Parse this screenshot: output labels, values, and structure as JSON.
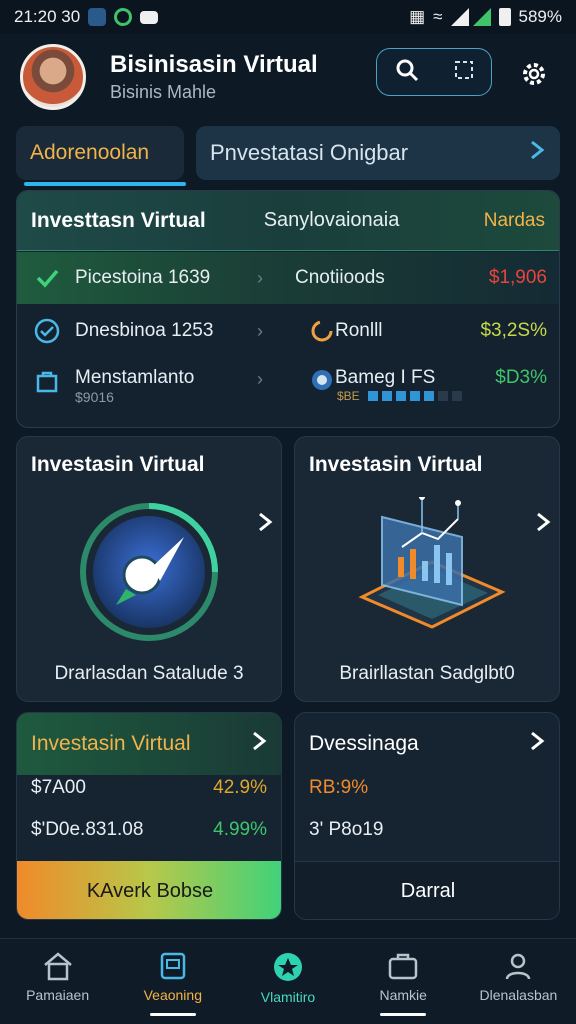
{
  "status_bar": {
    "time": "21:20 30",
    "battery": "589%"
  },
  "header": {
    "title": "Bisinisasin Virtual",
    "subtitle": "Bisinis Mahle"
  },
  "tabs": {
    "primary_label": "Adorenoolan",
    "secondary_label": "Pnvestatasi Onigbar"
  },
  "invest_card": {
    "title": "Investtasn Virtual",
    "col2": "Sanylovaionaia",
    "col3": "Nardas",
    "rows": [
      {
        "label": "Picestoina 1639",
        "right_label": "Cnotiioods",
        "value": "$1,906",
        "value_color": "#e8453c"
      },
      {
        "label": "Dnesbinoa 1253",
        "right_label": "Ronlll",
        "value": "$3,2S%",
        "value_color": "#c7d94a"
      },
      {
        "label": "Menstamlanto",
        "sublabel": "$9016",
        "right_label": "Bameg I FS",
        "progress_label": "$BE",
        "value": "$D3%",
        "value_color": "#3fc46a"
      }
    ],
    "progress": 0.72
  },
  "features": [
    {
      "title": "Investasin Virtual",
      "caption": "Drarlasdan Satalude 3",
      "icon": "compass-icon"
    },
    {
      "title": "Investasin Virtual",
      "caption": "Brairllastan Sadglbt0",
      "icon": "chart-icon"
    }
  ],
  "lower_cards": {
    "a": {
      "title": "Investasin Virtual",
      "row1_value": "$7A00",
      "row1_change": "42.9%",
      "row2_value": "$'D0e.831.08",
      "row2_change": "4.99%",
      "cta": "KAverk Bobse"
    },
    "b": {
      "title": "Dvessinaga",
      "row1_value": "RB:9%",
      "row2_value": "3' P8o19",
      "cta": "Darral"
    }
  },
  "bottom_nav": [
    {
      "label": "Pamaiaen",
      "icon": "home-icon"
    },
    {
      "label": "Veaoning",
      "icon": "wallet-icon"
    },
    {
      "label": "Vlamitiro",
      "icon": "star-icon"
    },
    {
      "label": "Namkie",
      "icon": "briefcase-icon"
    },
    {
      "label": "Dlenalasban",
      "icon": "user-icon"
    }
  ],
  "colors": {
    "accent_orange": "#f2b34a",
    "accent_blue": "#2fb5ee",
    "positive_green": "#3fc46a",
    "negative_red": "#e8453c"
  }
}
